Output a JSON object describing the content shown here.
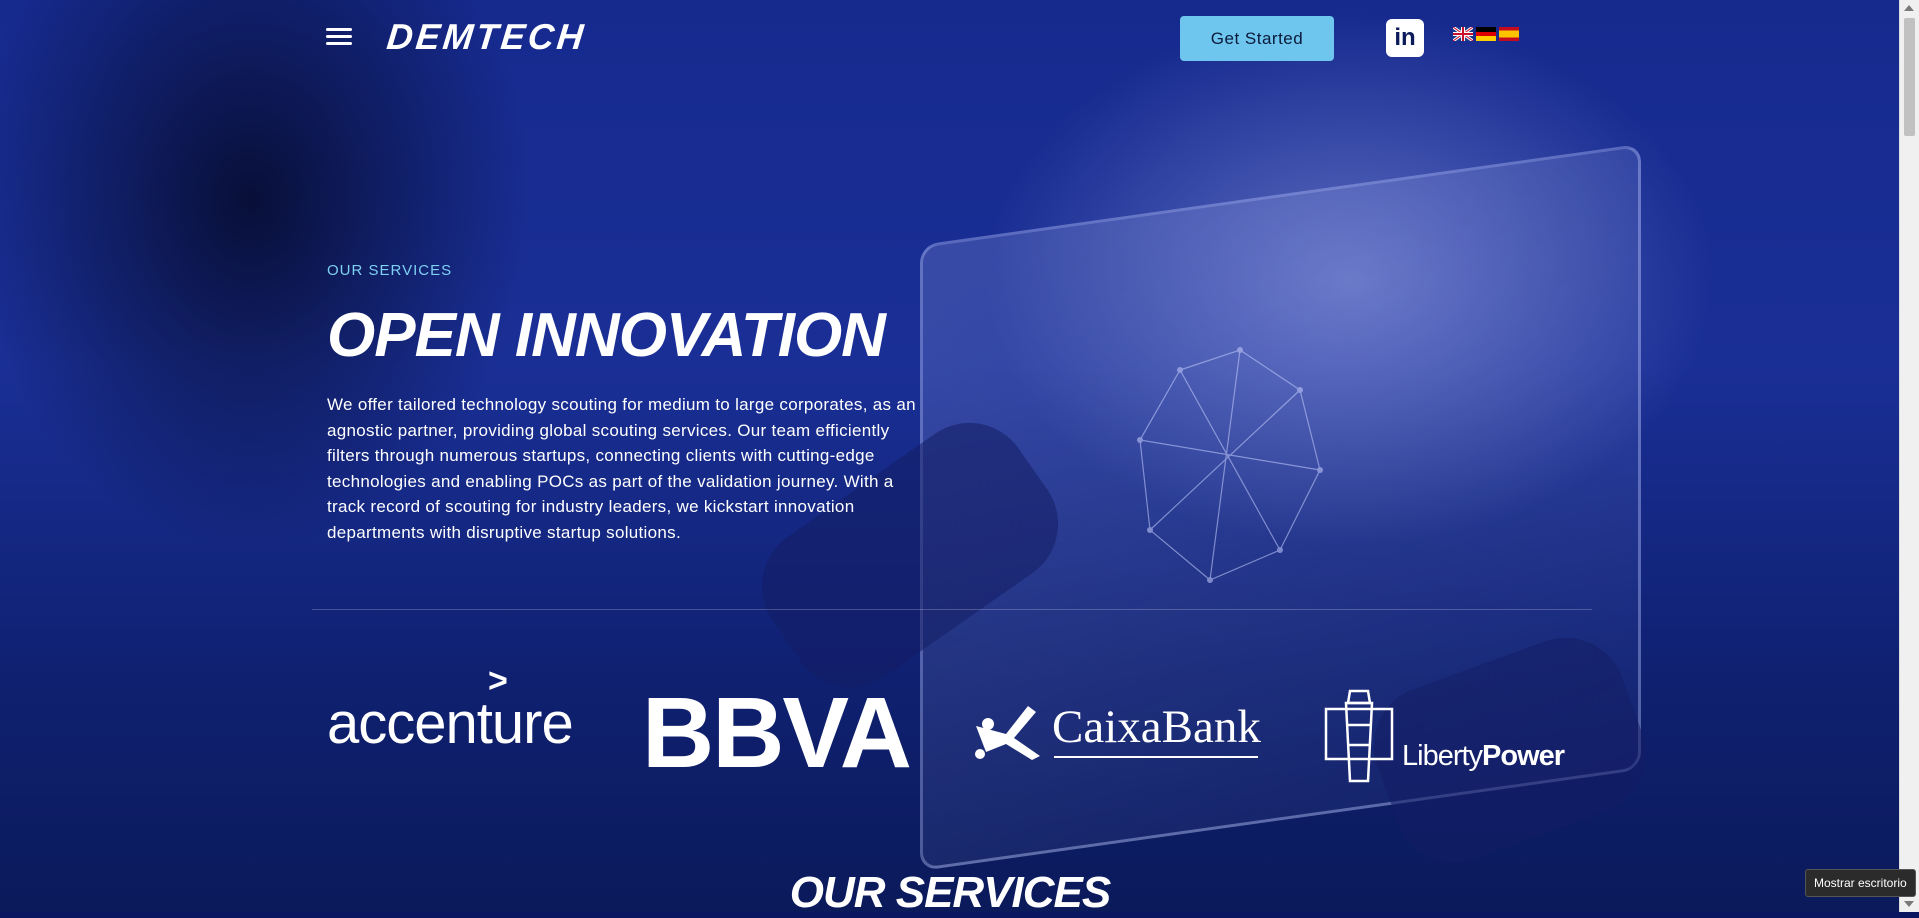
{
  "header": {
    "logo": "DEMTECH",
    "cta_label": "Get Started",
    "linkedin_label": "in",
    "menu_icon": "hamburger-menu-icon",
    "languages": [
      "English",
      "Deutsch",
      "Español"
    ]
  },
  "hero": {
    "eyebrow": "OUR SERVICES",
    "title": "OPEN INNOVATION",
    "description": "We offer tailored technology scouting for medium to large corporates, as an agnostic partner, providing global scouting services. Our team efficiently filters through numerous startups, connecting clients with cutting-edge technologies and enabling POCs as part of the validation journey. With a track record of scouting for industry leaders, we kickstart innovation departments with disruptive startup solutions."
  },
  "clients": {
    "accenture": "accenture",
    "bbva": "BBVA",
    "caixabank": "CaixaBank",
    "liberty_a": "Liberty",
    "liberty_b": "Power"
  },
  "section": {
    "title": "OUR SERVICES"
  },
  "tooltip": {
    "text": "Mostrar escritorio"
  },
  "colors": {
    "accent": "#6ec6ef",
    "eyebrow": "#7fd0f3",
    "background": "#162a8e"
  }
}
